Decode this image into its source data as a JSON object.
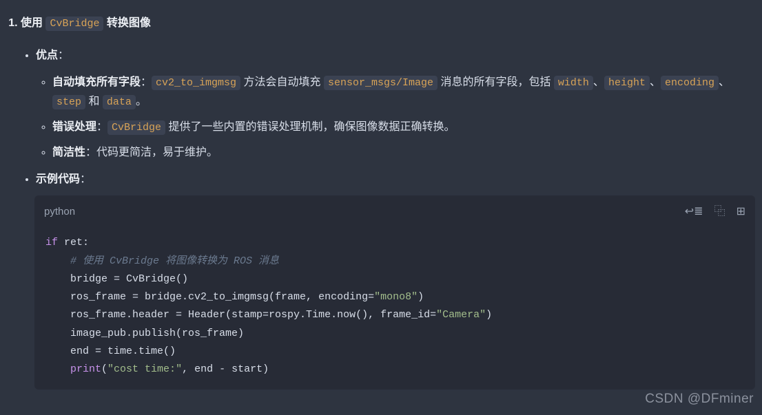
{
  "heading": {
    "prefix": "使用 ",
    "code": "CvBridge",
    "suffix": " 转换图像"
  },
  "advantages_label": "优点",
  "adv_items": [
    {
      "title": "自动填充所有字段",
      "seg1": "：",
      "code1": "cv2_to_imgmsg",
      "seg2": " 方法会自动填充 ",
      "code2": "sensor_msgs/Image",
      "seg3": " 消息的所有字段，包括 ",
      "code3": "width",
      "seg4": "、",
      "code4": "height",
      "seg5": "、",
      "code5": "encoding",
      "seg6": "、",
      "code6": "step",
      "seg7": " 和 ",
      "code7": "data",
      "seg8": "。"
    },
    {
      "title": "错误处理",
      "seg1": "：",
      "code1": "CvBridge",
      "seg2": " 提供了一些内置的错误处理机制，确保图像数据正确转换。"
    },
    {
      "title": "简洁性",
      "seg1": "：代码更简洁，易于维护。"
    }
  ],
  "example_label": "示例代码",
  "code": {
    "lang": "python",
    "l1_kw": "if",
    "l1_rest": " ret:",
    "l2_cmt": "# 使用 CvBridge 将图像转换为 ROS 消息",
    "l3": "    bridge = CvBridge()",
    "l4a": "    ros_frame = bridge.cv2_to_imgmsg(frame, encoding=",
    "l4s": "\"mono8\"",
    "l4b": ")",
    "l5a": "    ros_frame.header = Header(stamp=rospy.Time.now(), frame_id=",
    "l5s": "\"Camera\"",
    "l5b": ")",
    "l6": "    image_pub.publish(ros_frame)",
    "l7": "    end = time.time()",
    "l8a": "    ",
    "l8fn": "print",
    "l8b": "(",
    "l8s": "\"cost time:\"",
    "l8c": ", end - start)"
  },
  "icons": {
    "wrap": "↩≣",
    "copy": "⿻",
    "expand": "⊞"
  },
  "watermark": "CSDN @DFminer"
}
